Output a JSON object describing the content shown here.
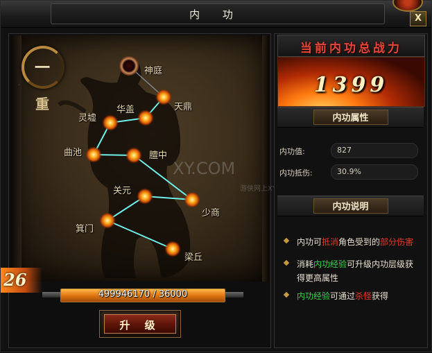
{
  "window": {
    "title": "内 功",
    "close_label": "X"
  },
  "level": {
    "numeral": "一",
    "layer": "重"
  },
  "stage_number": "26",
  "acupoints": [
    {
      "name": "神庭",
      "active": false
    },
    {
      "name": "天鼎",
      "active": true
    },
    {
      "name": "华盖",
      "active": true
    },
    {
      "name": "灵墟",
      "active": true
    },
    {
      "name": "膻中",
      "active": true
    },
    {
      "name": "曲池",
      "active": true
    },
    {
      "name": "关元",
      "active": true
    },
    {
      "name": "少商",
      "active": true
    },
    {
      "name": "箕门",
      "active": true
    },
    {
      "name": "梁丘",
      "active": true
    }
  ],
  "progress": {
    "text": "499946170 / 36000",
    "current": 499946170,
    "max": 36000,
    "fraction": 1.0
  },
  "upgrade_button": "升 级",
  "power": {
    "title": "当前内功总战力",
    "value": "1399"
  },
  "attributes": {
    "header": "内功属性",
    "items": [
      {
        "label": "内功值:",
        "value": "827"
      },
      {
        "label": "内功抵伤:",
        "value": "30.9%"
      }
    ]
  },
  "description": {
    "header": "内功说明",
    "lines": [
      {
        "parts": [
          {
            "t": "内功可",
            "c": ""
          },
          {
            "t": "抵消",
            "c": "red"
          },
          {
            "t": "角色受到的",
            "c": ""
          },
          {
            "t": "部分伤害",
            "c": "red"
          }
        ]
      },
      {
        "parts": [
          {
            "t": "消耗",
            "c": ""
          },
          {
            "t": "内功经验",
            "c": "green"
          },
          {
            "t": "可升级内功层级获得更高属性",
            "c": ""
          }
        ]
      },
      {
        "parts": [
          {
            "t": "内功经验",
            "c": "green"
          },
          {
            "t": "可通过",
            "c": ""
          },
          {
            "t": "杀怪",
            "c": "red"
          },
          {
            "t": "获得",
            "c": ""
          }
        ]
      }
    ]
  },
  "watermark": {
    "main": "XY.COM",
    "sub": "游侠网上XY"
  },
  "colors": {
    "accent_red": "#e03a2a",
    "accent_green": "#3ad050",
    "fill_orange": "#e07810",
    "gold_border": "#b88a40"
  },
  "icons": {
    "close": "close-icon",
    "bullet": "diamond-bullet-icon",
    "acupoint": "glowing-orb-icon"
  }
}
